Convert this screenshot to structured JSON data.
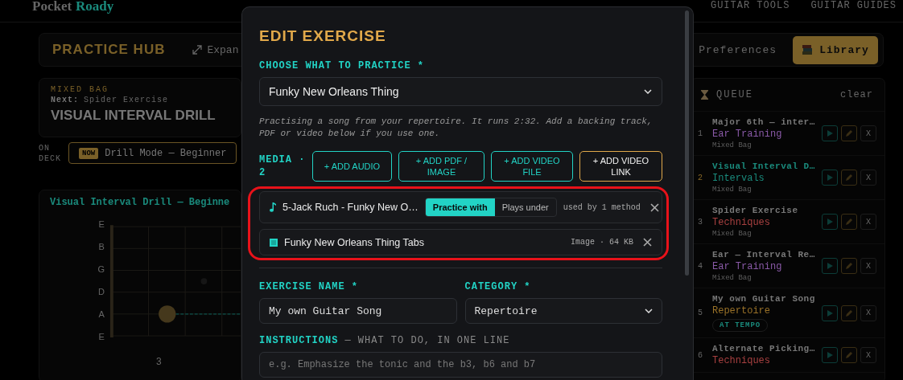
{
  "header": {
    "brand_first": "Pocket",
    "brand_second": "Roady",
    "nav": [
      "GUITAR TOOLS",
      "GUITAR GUIDES"
    ]
  },
  "hub": {
    "title": "PRACTICE HUB",
    "expand": "Expan",
    "preferences": "Preferences",
    "library": "Library"
  },
  "now_card": {
    "bag": "MIXED BAG",
    "next_label": "Next:",
    "next_value": "Spider Exercise",
    "title": "VISUAL INTERVAL DRILL"
  },
  "on_deck": {
    "label": "ON DECK",
    "badge": "NOW",
    "mode": "Drill Mode — Beginner"
  },
  "fretboard": {
    "title": "Visual Interval Drill — Beginne",
    "strings": [
      "E",
      "B",
      "G",
      "D",
      "A",
      "E"
    ],
    "fret_label": "3"
  },
  "queue": {
    "title": "QUEUE",
    "clear": "clear",
    "items": [
      {
        "number": "1",
        "title": "Major 6th — inter…",
        "category": "Ear Training",
        "color": "#8a5aa8",
        "sub": "Mixed Bag",
        "selected": false,
        "remove": "X"
      },
      {
        "number": "2",
        "title": "Visual Interval D…",
        "category": "Intervals",
        "color": "#1a8a7c",
        "sub": "Mixed Bag",
        "selected": true,
        "remove": "X"
      },
      {
        "number": "3",
        "title": "Spider Exercise",
        "category": "Techniques",
        "color": "#a84040",
        "sub": "Mixed Bag",
        "selected": false,
        "remove": "X"
      },
      {
        "number": "4",
        "title": "Ear — Interval Re…",
        "category": "Ear Training",
        "color": "#8a5aa8",
        "sub": "Mixed Bag",
        "selected": false,
        "remove": "X"
      },
      {
        "number": "5",
        "title": "My own Guitar Song",
        "category": "Repertoire",
        "color": "#9a7228",
        "badge": "AT TEMPO",
        "selected": false,
        "remove": "X"
      },
      {
        "number": "6",
        "title": "Alternate Picking…",
        "category": "Techniques",
        "color": "#a84040",
        "selected": false,
        "remove": "X"
      }
    ]
  },
  "modal": {
    "title": "EDIT EXERCISE",
    "choose_label": "CHOOSE WHAT TO PRACTICE *",
    "choose_value": "Funky New Orleans Thing",
    "hint": "Practising a song from your repertoire. It runs 2:32. Add a backing track, PDF or video below if you use one.",
    "media_label": "MEDIA · 2",
    "media_buttons": [
      {
        "label": "+ ADD AUDIO",
        "kind": "primary"
      },
      {
        "label": "+ ADD PDF / IMAGE",
        "kind": "primary"
      },
      {
        "label": "+ ADD VIDEO FILE",
        "kind": "primary"
      },
      {
        "label": "+ ADD VIDEO LINK",
        "kind": "accent"
      }
    ],
    "media": [
      {
        "kind": "audio",
        "name": "5-Jack Ruch - Funky New O…",
        "modes": [
          {
            "label": "Practice with",
            "selected": true
          },
          {
            "label": "Plays under",
            "selected": false
          }
        ],
        "meta": "used by 1 method"
      },
      {
        "kind": "image",
        "name": "Funky New Orleans Thing Tabs",
        "meta": "Image · 64 KB"
      }
    ],
    "name_label": "EXERCISE NAME *",
    "name_value": "My own Guitar Song",
    "category_label": "CATEGORY *",
    "category_value": "Repertoire",
    "instructions_label": "INSTRUCTIONS",
    "instructions_hint": "— WHAT TO DO, IN ONE LINE",
    "instructions_placeholder": "e.g. Emphasize the tonic and the b3, b6 and b7"
  }
}
